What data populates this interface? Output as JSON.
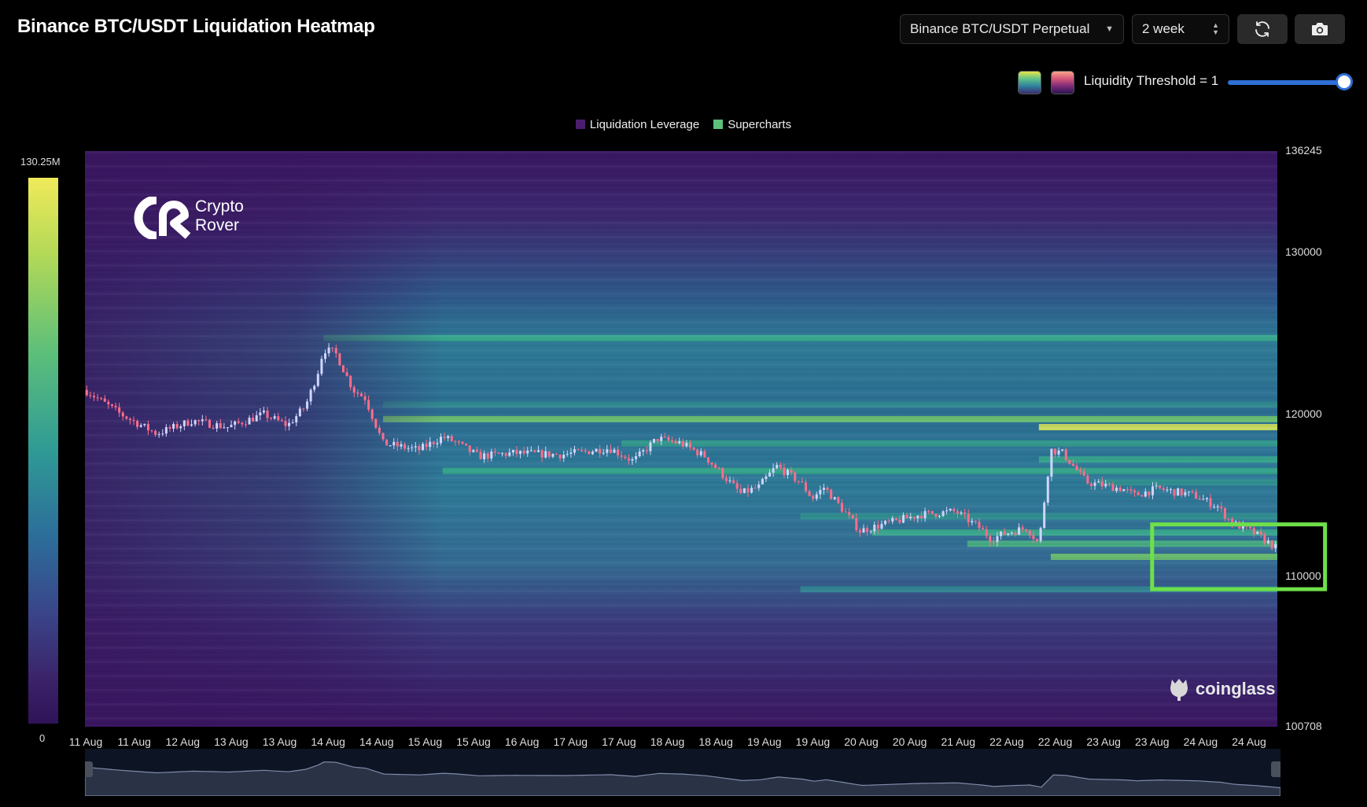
{
  "header": {
    "title": "Binance BTC/USDT Liquidation Heatmap",
    "exchange_select": "Binance BTC/USDT Perpetual",
    "period_select": "2 week",
    "threshold_label": "Liquidity Threshold = 1"
  },
  "legend": {
    "items": [
      {
        "label": "Liquidation Leverage",
        "color": "#4b1d6e"
      },
      {
        "label": "Supercharts",
        "color": "#5cc07a"
      }
    ]
  },
  "colorbar": {
    "max_label": "130.25M",
    "min_label": "0"
  },
  "watermarks": {
    "logo_line1": "Crypto",
    "logo_line2": "Rover",
    "brand": "coinglass"
  },
  "colors": {
    "highlight_box": "#6ee04a",
    "background": "#3a1660",
    "candle_up": "#cfd6ff",
    "candle_down": "#ff6d8a"
  },
  "chart_data": {
    "type": "heatmap",
    "y_axis": {
      "min": 100708,
      "max": 136245,
      "ticks": [
        136245,
        130000,
        120000,
        110000,
        100708
      ]
    },
    "x_axis": {
      "ticks": [
        "11 Aug",
        "11 Aug",
        "12 Aug",
        "13 Aug",
        "13 Aug",
        "14 Aug",
        "14 Aug",
        "15 Aug",
        "15 Aug",
        "16 Aug",
        "17 Aug",
        "17 Aug",
        "18 Aug",
        "18 Aug",
        "19 Aug",
        "19 Aug",
        "20 Aug",
        "20 Aug",
        "21 Aug",
        "22 Aug",
        "22 Aug",
        "23 Aug",
        "23 Aug",
        "24 Aug",
        "24 Aug"
      ]
    },
    "price_path": {
      "t": [
        0,
        0.03,
        0.06,
        0.09,
        0.12,
        0.15,
        0.17,
        0.185,
        0.195,
        0.2,
        0.21,
        0.225,
        0.235,
        0.25,
        0.28,
        0.3,
        0.31,
        0.33,
        0.36,
        0.4,
        0.44,
        0.46,
        0.48,
        0.5,
        0.52,
        0.55,
        0.565,
        0.58,
        0.6,
        0.61,
        0.62,
        0.65,
        0.67,
        0.7,
        0.73,
        0.75,
        0.76,
        0.77,
        0.79,
        0.8,
        0.81,
        0.82,
        0.84,
        0.87,
        0.88,
        0.9,
        0.93,
        0.95,
        0.958,
        0.962,
        0.98,
        1.0
      ],
      "price": [
        121500,
        120000,
        118800,
        119600,
        119200,
        120000,
        119300,
        120500,
        122500,
        124000,
        123800,
        121500,
        121000,
        118200,
        117800,
        118600,
        118300,
        117400,
        117600,
        117500,
        117900,
        117100,
        118500,
        118200,
        117400,
        115100,
        115500,
        116800,
        115800,
        114800,
        115500,
        112800,
        113200,
        113800,
        114000,
        113000,
        112300,
        112600,
        113000,
        112000,
        117800,
        117600,
        115800,
        115400,
        115000,
        115400,
        115000,
        114300,
        113600,
        113300,
        112700,
        111700
      ]
    },
    "liquidity_bands": [
      {
        "price": 124700,
        "intensity": 0.55,
        "start": 0.2
      },
      {
        "price": 120600,
        "intensity": 0.42,
        "start": 0.25
      },
      {
        "price": 119700,
        "intensity": 0.7,
        "start": 0.25
      },
      {
        "price": 119200,
        "intensity": 0.95,
        "start": 0.8
      },
      {
        "price": 118200,
        "intensity": 0.5,
        "start": 0.45
      },
      {
        "price": 117200,
        "intensity": 0.55,
        "start": 0.8
      },
      {
        "price": 116500,
        "intensity": 0.55,
        "start": 0.3
      },
      {
        "price": 115800,
        "intensity": 0.45,
        "start": 0.85
      },
      {
        "price": 113700,
        "intensity": 0.45,
        "start": 0.6
      },
      {
        "price": 112700,
        "intensity": 0.55,
        "start": 0.66
      },
      {
        "price": 112000,
        "intensity": 0.6,
        "start": 0.74
      },
      {
        "price": 111200,
        "intensity": 0.7,
        "start": 0.81
      },
      {
        "price": 109200,
        "intensity": 0.4,
        "start": 0.6
      }
    ],
    "highlight_box": {
      "t_start": 0.895,
      "t_end": 1.04,
      "price_low": 109200,
      "price_high": 113200
    }
  }
}
